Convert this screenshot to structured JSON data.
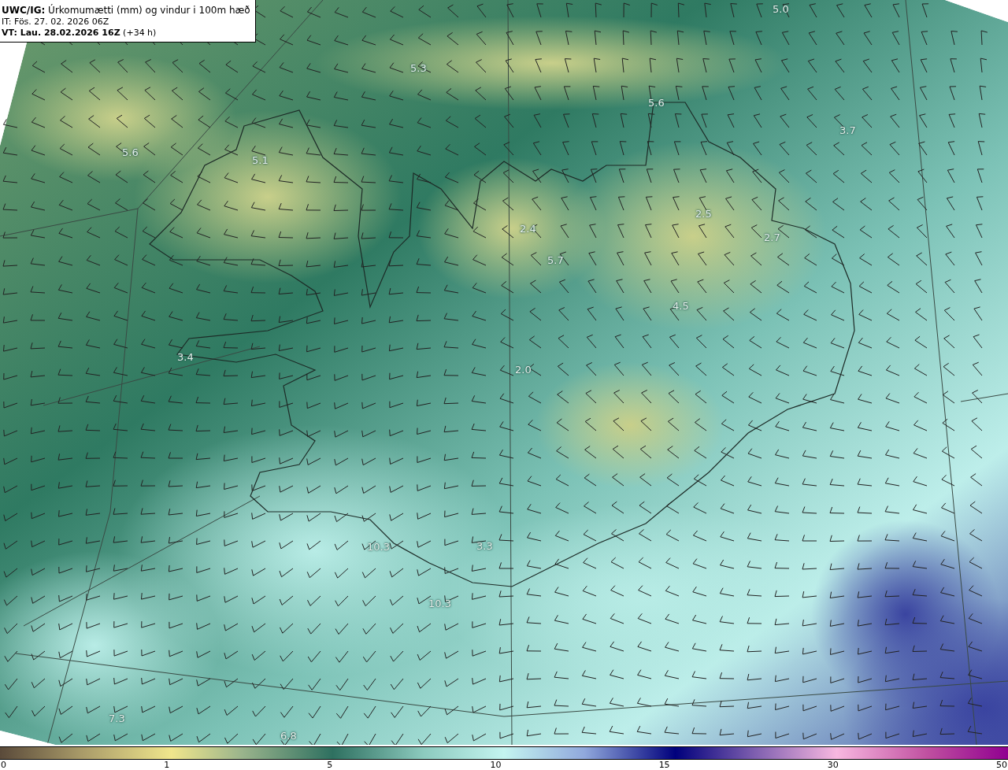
{
  "header": {
    "title": "**UWC/IG:** Úrkomumætti (mm) og vindur i 100m hæð",
    "issue_time": "IT: Fös. 27. 02. 2026 06Z",
    "valid_time": "**VT: Lau. 28.02.2026 16Z** (+34 h)"
  },
  "map_labels": [
    {
      "text": "5.0"
    },
    {
      "text": "5.3"
    },
    {
      "text": "5.6"
    },
    {
      "text": "5.6"
    },
    {
      "text": "3.7"
    },
    {
      "text": "5.1"
    },
    {
      "text": "2.5"
    },
    {
      "text": "2.7"
    },
    {
      "text": "2.4"
    },
    {
      "text": "5.7"
    },
    {
      "text": "4.5"
    },
    {
      "text": "3.4"
    },
    {
      "text": "2.0"
    },
    {
      "text": "3.3"
    },
    {
      "text": "10.3"
    },
    {
      "text": "10.3"
    },
    {
      "text": "7.3"
    },
    {
      "text": "6.8"
    }
  ],
  "colorbar": {
    "ticks": [
      "0",
      "1",
      "5",
      "10",
      "15",
      "30",
      "50"
    ]
  }
}
